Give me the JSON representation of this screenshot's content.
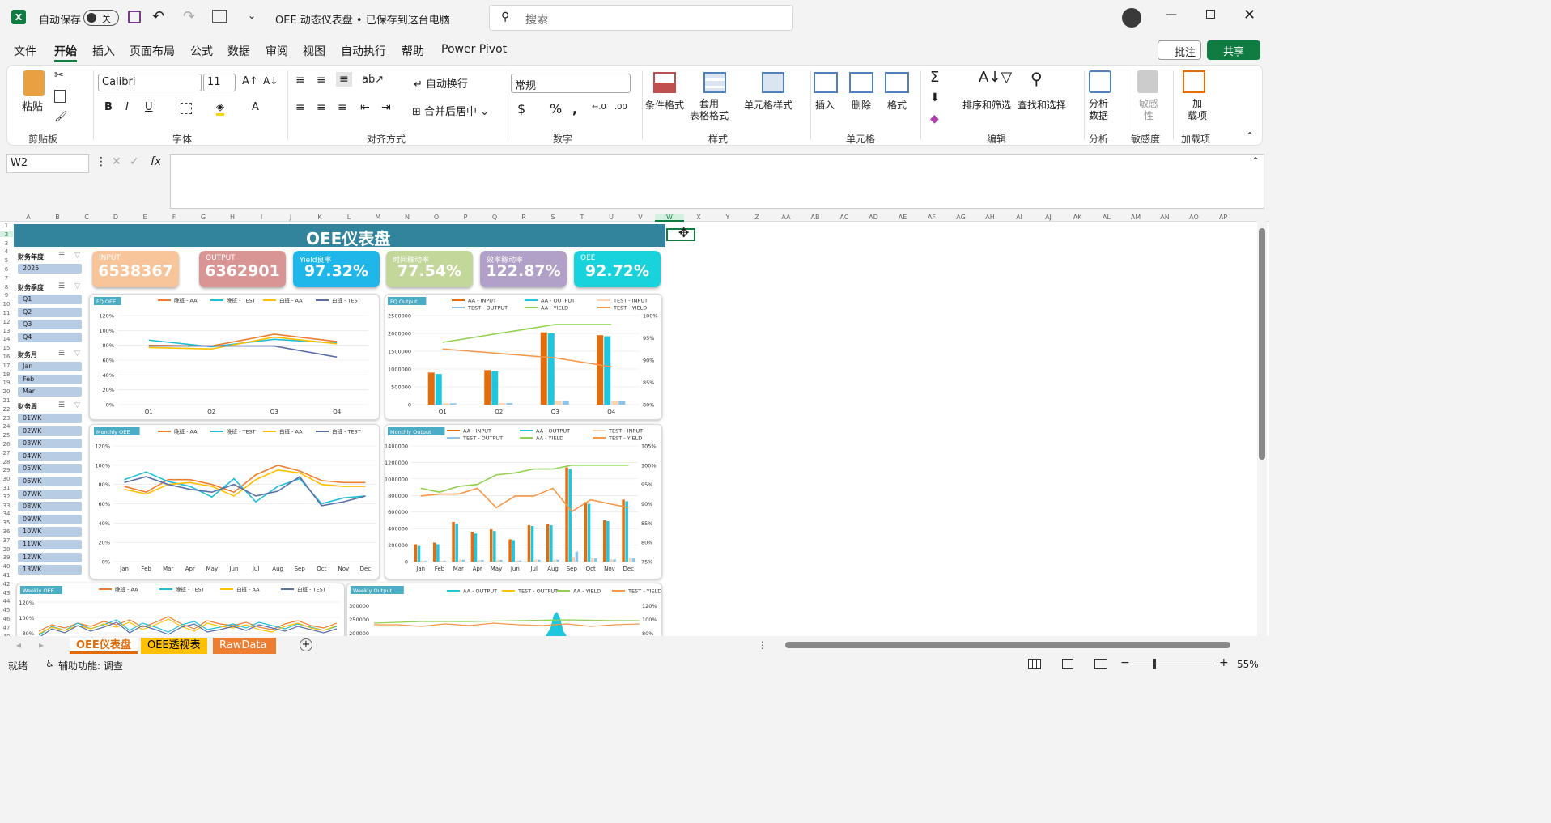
{
  "titlebar": {
    "autosave": "自动保存",
    "toggle": "关",
    "doc_title": "OEE 动态仪表盘 • 已保存到这台电脑",
    "search_placeholder": "搜索"
  },
  "menu": [
    "文件",
    "开始",
    "插入",
    "页面布局",
    "公式",
    "数据",
    "审阅",
    "视图",
    "自动执行",
    "帮助",
    "Power Pivot"
  ],
  "menu_right": {
    "comment": "批注",
    "share": "共享"
  },
  "ribbon": {
    "clipboard": {
      "paste": "粘贴",
      "group": "剪贴板"
    },
    "font": {
      "name": "Calibri",
      "size": "11",
      "group": "字体"
    },
    "align": {
      "wrap": "自动换行",
      "merge": "合并后居中",
      "group": "对齐方式"
    },
    "number": {
      "format": "常规",
      "group": "数字"
    },
    "styles": {
      "cond": "条件格式",
      "table": "套用\n表格格式",
      "cell": "单元格样式",
      "group": "样式"
    },
    "cells": {
      "insert": "插入",
      "delete": "删除",
      "format": "格式",
      "group": "单元格"
    },
    "edit": {
      "sort": "排序和筛选",
      "find": "查找和选择",
      "group": "编辑"
    },
    "analysis": {
      "btn": "分析\n数据",
      "group": "分析"
    },
    "sens": {
      "btn": "敏感\n性",
      "group": "敏感度"
    },
    "addin": {
      "btn": "加\n载项",
      "group": "加载项"
    }
  },
  "formula_bar": {
    "name_box": "W2",
    "fx": "fx"
  },
  "columns": [
    "A",
    "B",
    "C",
    "D",
    "E",
    "F",
    "G",
    "H",
    "I",
    "J",
    "K",
    "L",
    "M",
    "N",
    "O",
    "P",
    "Q",
    "R",
    "S",
    "T",
    "U",
    "V",
    "W",
    "X",
    "Y",
    "Z",
    "AA",
    "AB",
    "AC",
    "AD",
    "AE",
    "AF",
    "AG",
    "AH",
    "AI",
    "AJ",
    "AK",
    "AL",
    "AM",
    "AN",
    "AO",
    "AP"
  ],
  "dashboard": {
    "title": "OEE仪表盘",
    "kpis": [
      {
        "label": "INPUT",
        "value": "6538367",
        "color": "#f8c49a"
      },
      {
        "label": "OUTPUT",
        "value": "6362901",
        "color": "#d99594"
      },
      {
        "label": "Yield良率",
        "value": "97.32%",
        "color": "#1fb7ea"
      },
      {
        "label": "时间稼动率",
        "value": "77.54%",
        "color": "#c4d79b"
      },
      {
        "label": "效率稼动率",
        "value": "122.87%",
        "color": "#b1a0c7"
      },
      {
        "label": "OEE",
        "value": "92.72%",
        "color": "#19d3dc"
      }
    ],
    "slicers": {
      "year": {
        "title": "财务年度",
        "items": [
          "2025"
        ]
      },
      "quarter": {
        "title": "财务季度",
        "items": [
          "Q1",
          "Q2",
          "Q3",
          "Q4"
        ]
      },
      "month": {
        "title": "财务月",
        "items": [
          "Jan",
          "Feb",
          "Mar"
        ]
      },
      "week": {
        "title": "财务周",
        "items": [
          "01WK",
          "02WK",
          "03WK",
          "04WK",
          "05WK",
          "06WK",
          "07WK",
          "08WK",
          "09WK",
          "10WK",
          "11WK",
          "12WK",
          "13WK"
        ]
      }
    }
  },
  "chart_data": [
    {
      "type": "line",
      "title": "FQ OEE",
      "categories": [
        "Q1",
        "Q2",
        "Q3",
        "Q4"
      ],
      "ylim": [
        0,
        120
      ],
      "series": [
        {
          "name": "晚班 - AA",
          "values": [
            80,
            79,
            95,
            85
          ],
          "color": "#ed7d31"
        },
        {
          "name": "晚班 - TEST",
          "values": [
            87,
            78,
            88,
            83
          ],
          "color": "#1fbfd8"
        },
        {
          "name": "白班 - AA",
          "values": [
            77,
            75,
            91,
            82
          ],
          "color": "#ffc000"
        },
        {
          "name": "白班 - TEST",
          "values": [
            79,
            79,
            79,
            64
          ],
          "color": "#5a6ea8"
        }
      ]
    },
    {
      "type": "bar",
      "title": "FQ Output",
      "categories": [
        "Q1",
        "Q2",
        "Q3",
        "Q4"
      ],
      "ylim": [
        0,
        2500000
      ],
      "y2lim": [
        80,
        100
      ],
      "series": [
        {
          "name": "AA - INPUT",
          "values": [
            900000,
            970000,
            2030000,
            1950000
          ],
          "color": "#e46c0a"
        },
        {
          "name": "AA - OUTPUT",
          "values": [
            860000,
            940000,
            2000000,
            1920000
          ],
          "color": "#1fc6de"
        },
        {
          "name": "TEST - INPUT",
          "values": [
            40000,
            45000,
            100000,
            95000
          ],
          "color": "#fbd4b4"
        },
        {
          "name": "TEST - OUTPUT",
          "values": [
            38000,
            42000,
            98000,
            92000
          ],
          "color": "#8cc3e8"
        },
        {
          "name": "AA - YIELD",
          "values": [
            94,
            96,
            98,
            98
          ],
          "color": "#92d050",
          "axis": "y2"
        },
        {
          "name": "TEST - YIELD",
          "values": [
            92.5,
            91.5,
            90.5,
            88.5
          ],
          "color": "#f79646",
          "axis": "y2"
        }
      ]
    },
    {
      "type": "line",
      "title": "Monthly OEE",
      "categories": [
        "Jan",
        "Feb",
        "Mar",
        "Apr",
        "May",
        "Jun",
        "Jul",
        "Aug",
        "Sep",
        "Oct",
        "Nov",
        "Dec"
      ],
      "ylim": [
        0,
        120
      ],
      "series": [
        {
          "name": "晚班 - AA",
          "values": [
            78,
            72,
            85,
            85,
            80,
            72,
            90,
            100,
            94,
            84,
            82,
            82
          ],
          "color": "#ed7d31"
        },
        {
          "name": "晚班 - TEST",
          "values": [
            85,
            93,
            83,
            78,
            67,
            86,
            62,
            78,
            86,
            60,
            66,
            68
          ],
          "color": "#1fbfd8"
        },
        {
          "name": "白班 - AA",
          "values": [
            75,
            70,
            80,
            82,
            78,
            68,
            85,
            95,
            92,
            80,
            78,
            78
          ],
          "color": "#ffc000"
        },
        {
          "name": "白班 - TEST",
          "values": [
            82,
            88,
            80,
            75,
            72,
            80,
            68,
            73,
            88,
            58,
            62,
            68
          ],
          "color": "#5a6ea8"
        }
      ]
    },
    {
      "type": "bar",
      "title": "Monthly Output",
      "categories": [
        "Jan",
        "Feb",
        "Mar",
        "Apr",
        "May",
        "Jun",
        "Jul",
        "Aug",
        "Sep",
        "Oct",
        "Nov",
        "Dec"
      ],
      "ylim": [
        0,
        1400000
      ],
      "y2lim": [
        75,
        105
      ],
      "series": [
        {
          "name": "AA - INPUT",
          "values": [
            210000,
            230000,
            480000,
            360000,
            390000,
            270000,
            440000,
            450000,
            1140000,
            720000,
            500000,
            750000
          ],
          "color": "#e46c0a"
        },
        {
          "name": "AA - OUTPUT",
          "values": [
            190000,
            210000,
            460000,
            340000,
            370000,
            260000,
            430000,
            440000,
            1120000,
            700000,
            490000,
            730000
          ],
          "color": "#1fc6de"
        },
        {
          "name": "TEST - INPUT",
          "values": [
            10000,
            12000,
            25000,
            20000,
            22000,
            15000,
            25000,
            25000,
            60000,
            40000,
            28000,
            40000
          ],
          "color": "#fbd4b4"
        },
        {
          "name": "TEST - OUTPUT",
          "values": [
            9000,
            11000,
            23000,
            19000,
            20000,
            14000,
            23000,
            23000,
            120000,
            38000,
            26000,
            38000
          ],
          "color": "#8cc3e8"
        },
        {
          "name": "AA - YIELD",
          "values": [
            94,
            93,
            94.5,
            95,
            97.5,
            98,
            99,
            99,
            100,
            100,
            100,
            100
          ],
          "color": "#92d050",
          "axis": "y2"
        },
        {
          "name": "TEST - YIELD",
          "values": [
            92,
            92.5,
            92.5,
            94,
            89,
            92,
            92,
            94,
            88,
            91,
            90,
            89
          ],
          "color": "#f79646",
          "axis": "y2"
        }
      ]
    },
    {
      "type": "line",
      "title": "Weekly OEE",
      "ylim": [
        80,
        120
      ],
      "series": [
        {
          "name": "晚班 - AA",
          "color": "#ed7d31"
        },
        {
          "name": "晚班 - TEST",
          "color": "#1fbfd8"
        },
        {
          "name": "白班 - AA",
          "color": "#ffc000"
        },
        {
          "name": "白班 - TEST",
          "color": "#5a6ea8"
        }
      ]
    },
    {
      "type": "area",
      "title": "Weekly Output",
      "ylim": [
        200000,
        300000
      ],
      "y2lim": [
        80,
        120
      ],
      "series": [
        {
          "name": "AA - OUTPUT",
          "color": "#1fc6de"
        },
        {
          "name": "TEST - OUTPUT",
          "color": "#ffc000"
        },
        {
          "name": "AA - YIELD",
          "color": "#92d050"
        },
        {
          "name": "TEST - YIELD",
          "color": "#f79646"
        }
      ]
    }
  ],
  "sheets": [
    "OEE仪表盘",
    "OEE透视表",
    "RawData"
  ],
  "status": {
    "ready": "就绪",
    "accessibility": "辅助功能: 调查",
    "zoom": "55%"
  }
}
